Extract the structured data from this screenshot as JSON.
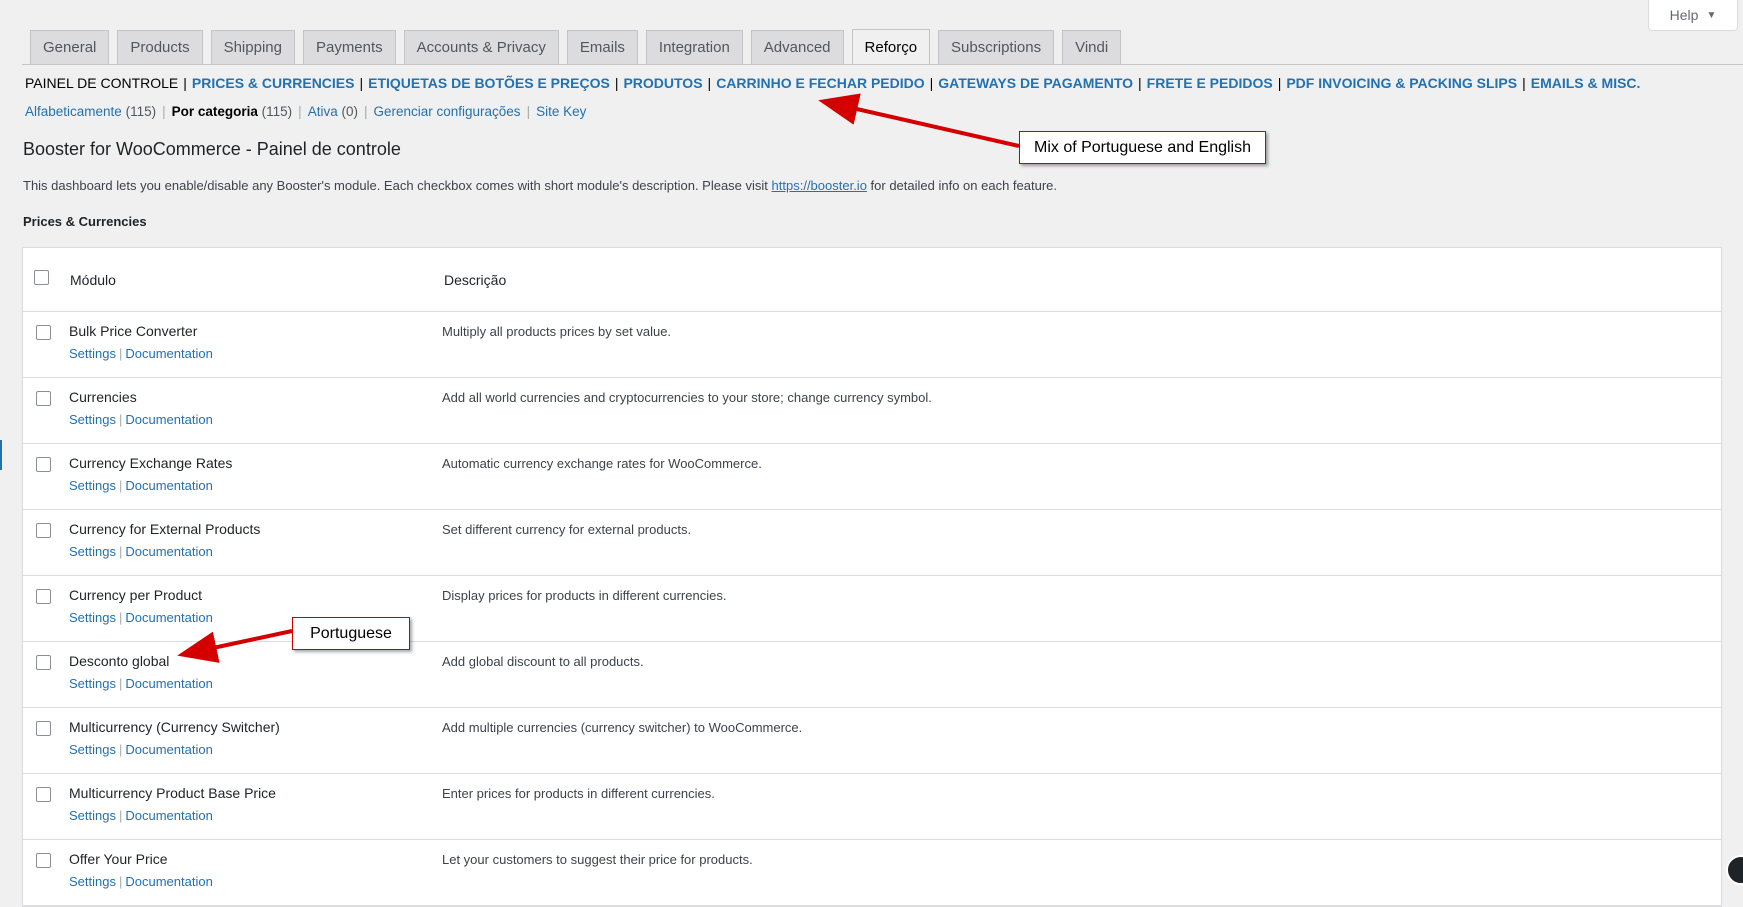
{
  "help": {
    "label": "Help",
    "caret": "▼"
  },
  "tabs": [
    {
      "label": "General"
    },
    {
      "label": "Products"
    },
    {
      "label": "Shipping"
    },
    {
      "label": "Payments"
    },
    {
      "label": "Accounts & Privacy"
    },
    {
      "label": "Emails"
    },
    {
      "label": "Integration"
    },
    {
      "label": "Advanced"
    },
    {
      "label": "Reforço",
      "active": true
    },
    {
      "label": "Subscriptions"
    },
    {
      "label": "Vindi"
    }
  ],
  "categories": {
    "current": "PAINEL DE CONTROLE",
    "links": [
      "PRICES & CURRENCIES",
      "ETIQUETAS DE BOTÕES E PREÇOS",
      "PRODUTOS",
      "CARRINHO E FECHAR PEDIDO",
      "GATEWAYS DE PAGAMENTO",
      "FRETE E PEDIDOS",
      "PDF INVOICING & PACKING SLIPS",
      "EMAILS & MISC."
    ]
  },
  "subnav": {
    "alphabetical": "Alfabeticamente",
    "alphabetical_count": "(115)",
    "by_category": "Por categoria",
    "by_category_count": "(115)",
    "active": "Ativa",
    "active_count": "(0)",
    "manage": "Gerenciar configurações",
    "site_key": "Site Key"
  },
  "page": {
    "title": "Booster for WooCommerce - Painel de controle",
    "description_before": "This dashboard lets you enable/disable any Booster's module. Each checkbox comes with short module's description. Please visit ",
    "description_link": "https://booster.io",
    "description_after": " for detailed info on each feature.",
    "section": "Prices & Currencies"
  },
  "table": {
    "col_module": "Módulo",
    "col_description": "Descrição",
    "settings_label": "Settings",
    "docs_label": "Documentation",
    "rows": [
      {
        "name": "Bulk Price Converter",
        "desc": "Multiply all products prices by set value."
      },
      {
        "name": "Currencies",
        "desc": "Add all world currencies and cryptocurrencies to your store; change currency symbol."
      },
      {
        "name": "Currency Exchange Rates",
        "desc": "Automatic currency exchange rates for WooCommerce."
      },
      {
        "name": "Currency for External Products",
        "desc": "Set different currency for external products."
      },
      {
        "name": "Currency per Product",
        "desc": "Display prices for products in different currencies."
      },
      {
        "name": "Desconto global",
        "desc": "Add global discount to all products."
      },
      {
        "name": "Multicurrency (Currency Switcher)",
        "desc": "Add multiple currencies (currency switcher) to WooCommerce."
      },
      {
        "name": "Multicurrency Product Base Price",
        "desc": "Enter prices for products in different currencies."
      },
      {
        "name": "Offer Your Price",
        "desc": "Let your customers to suggest their price for products."
      }
    ]
  },
  "annotations": {
    "mix": "Mix of Portuguese and English",
    "portuguese": "Portuguese",
    "arrow_color": "#d40000"
  }
}
